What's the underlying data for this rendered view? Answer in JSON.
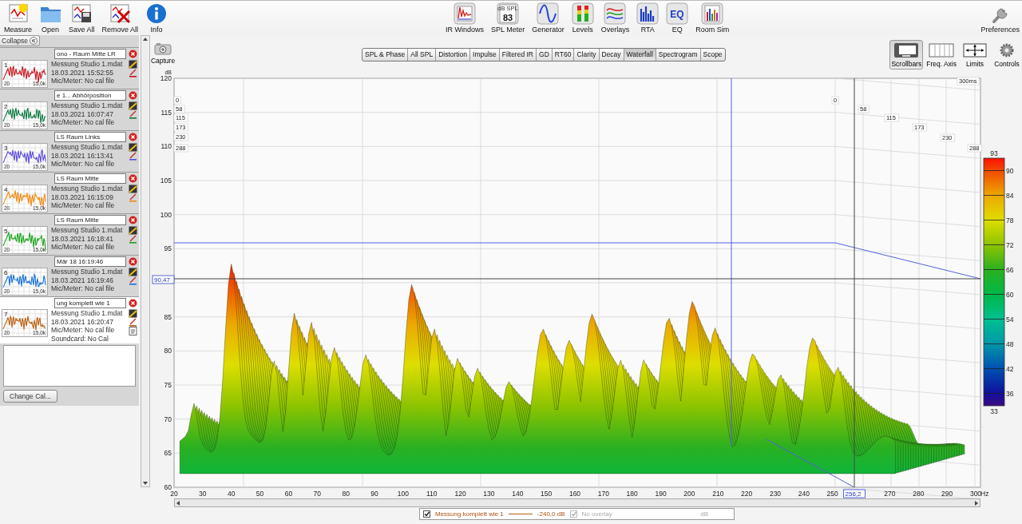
{
  "main_toolbar": [
    {
      "label": "Measure"
    },
    {
      "label": "Open"
    },
    {
      "label": "Save All"
    },
    {
      "label": "Remove All"
    },
    {
      "label": "Info"
    }
  ],
  "tool_windows": [
    {
      "label": "IR Windows"
    },
    {
      "label": "SPL Meter",
      "icon_text": [
        "dB SPL",
        "83"
      ]
    },
    {
      "label": "Generator"
    },
    {
      "label": "Levels"
    },
    {
      "label": "Overlays"
    },
    {
      "label": "RTA"
    },
    {
      "label": "EQ",
      "icon_text": [
        "EQ"
      ]
    },
    {
      "label": "Room Sim"
    }
  ],
  "preferences": {
    "label": "Preferences"
  },
  "sidebar": {
    "collapse_button": "Collapse",
    "measurements": [
      {
        "number": "1",
        "name": "ono - Raum Mitte LR",
        "file": "Messung Studio 1.mdat",
        "date": "18.03.2021 15:52:55",
        "mic": "Mic/Meter: No cal file",
        "axis_start": "20",
        "axis_end": "15,0k",
        "color": "#c8141e",
        "selected": false
      },
      {
        "number": "2",
        "name": "e 1... Abhörposition",
        "file": "Messung Studio 1.mdat",
        "date": "18.03.2021 16:07:47",
        "mic": "Mic/Meter: No cal file",
        "axis_start": "20",
        "axis_end": "15,0k",
        "color": "#0b7a3e",
        "selected": false
      },
      {
        "number": "3",
        "name": "LS Raum Links",
        "file": "Messung Studio 1.mdat",
        "date": "18.03.2021 16:13:41",
        "mic": "Mic/Meter: No cal file",
        "axis_start": "20",
        "axis_end": "15,0k",
        "color": "#5a4de0",
        "selected": false
      },
      {
        "number": "4",
        "name": "LS Raum Mitte",
        "file": "Messung Studio 1.mdat",
        "date": "18.03.2021 16:15:09",
        "mic": "Mic/Meter: No cal file",
        "axis_start": "20",
        "axis_end": "15,0k",
        "color": "#f08a10",
        "selected": false
      },
      {
        "number": "5",
        "name": "LS Raum Mitte",
        "file": "Messung Studio 1.mdat",
        "date": "18.03.2021 16:18:41",
        "mic": "Mic/Meter: No cal file",
        "axis_start": "20",
        "axis_end": "15,0k",
        "color": "#1aa51a",
        "selected": false
      },
      {
        "number": "6",
        "name": "Mär 18 16:19:46",
        "file": "Messung Studio 1.mdat",
        "date": "18.03.2021 16:19:46",
        "mic": "Mic/Meter: No cal file",
        "axis_start": "20",
        "axis_end": "15,0k",
        "color": "#1a6fd8",
        "selected": false
      },
      {
        "number": "7",
        "name": "ung komplett wie 1",
        "file": "Messung Studio 1.mdat",
        "date": "18.03.2021 16:20:47",
        "mic": "Mic/Meter: No cal file",
        "soundcard": "Soundcard: No Cal",
        "axis_start": "20",
        "axis_end": "15,0k",
        "color": "#b8600e",
        "selected": true
      }
    ],
    "change_cal_button": "Change Cal..."
  },
  "capture": {
    "label": "Capture"
  },
  "graph_tabs": [
    {
      "label": "SPL & Phase",
      "selected": false
    },
    {
      "label": "All SPL",
      "selected": false
    },
    {
      "label": "Distortion",
      "selected": false
    },
    {
      "label": "Impulse",
      "selected": false
    },
    {
      "label": "Filtered IR",
      "selected": false
    },
    {
      "label": "GD",
      "selected": false
    },
    {
      "label": "RT60",
      "selected": false
    },
    {
      "label": "Clarity",
      "selected": false
    },
    {
      "label": "Decay",
      "selected": false
    },
    {
      "label": "Waterfall",
      "selected": true
    },
    {
      "label": "Spectrogram",
      "selected": false
    },
    {
      "label": "Scope",
      "selected": false
    }
  ],
  "graph_tools": [
    {
      "label": "Scrollbars",
      "selected": true
    },
    {
      "label": "Freq. Axis",
      "selected": false
    },
    {
      "label": "Limits",
      "selected": false
    },
    {
      "label": "Controls",
      "selected": false
    }
  ],
  "plot": {
    "y_unit": "dB",
    "y_ticks": [
      "120",
      "115",
      "110",
      "105",
      "100",
      "95",
      "85",
      "80",
      "75",
      "70",
      "65",
      "60"
    ],
    "x_ticks": [
      "20",
      "30",
      "40",
      "50",
      "60",
      "70",
      "80",
      "90",
      "100",
      "110",
      "120",
      "130",
      "140",
      "150",
      "160",
      "170",
      "180",
      "190",
      "200",
      "210",
      "220",
      "230",
      "240",
      "250",
      "270",
      "280",
      "290",
      "300"
    ],
    "x_unit": "Hz",
    "time_labels_front": [
      "0",
      "58",
      "115",
      "173",
      "230",
      "288"
    ],
    "time_labels_back": [
      "0",
      "58",
      "115",
      "173",
      "230",
      "288"
    ],
    "time_end": "300ms",
    "cursor_level": "90,47",
    "cursor_frequency": "256,2",
    "color_scale": {
      "max": "93",
      "ticks": [
        "90",
        "84",
        "78",
        "72",
        "66",
        "60",
        "54",
        "48",
        "42",
        "36"
      ],
      "min": "33"
    }
  },
  "legend": {
    "trace": {
      "checked": true,
      "name": "Messung komplett wie 1",
      "offset": "-240,0 dB"
    },
    "overlay": {
      "checked": true,
      "disabled": true,
      "name": "No overlay",
      "unit": "dB"
    }
  }
}
